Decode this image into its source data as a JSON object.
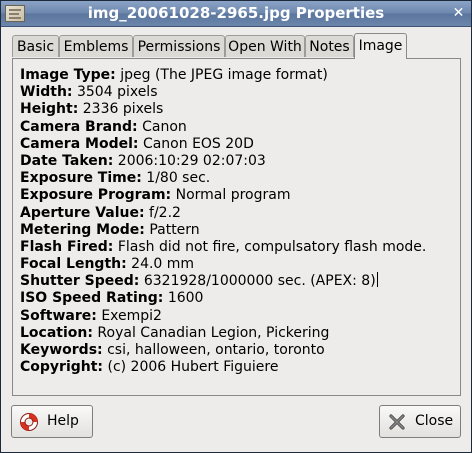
{
  "window": {
    "title": "img_20061028-2965.jpg Properties"
  },
  "icons": {
    "title": "image-file-icon",
    "close": "close-x-icon",
    "help": "lifebuoy-icon",
    "close_button": "close-x-icon"
  },
  "tabs": [
    {
      "label": "Basic",
      "active": false
    },
    {
      "label": "Emblems",
      "active": false
    },
    {
      "label": "Permissions",
      "active": false
    },
    {
      "label": "Open With",
      "active": false
    },
    {
      "label": "Notes",
      "active": false
    },
    {
      "label": "Image",
      "active": true
    }
  ],
  "fields": [
    {
      "label": "Image Type:",
      "value": "jpeg (The JPEG image format)"
    },
    {
      "label": "Width:",
      "value": "3504 pixels"
    },
    {
      "label": "Height:",
      "value": "2336 pixels"
    },
    {
      "label": "Camera Brand:",
      "value": "Canon"
    },
    {
      "label": "Camera Model:",
      "value": "Canon EOS 20D"
    },
    {
      "label": "Date Taken:",
      "value": "2006:10:29 02:07:03"
    },
    {
      "label": "Exposure Time:",
      "value": "1/80 sec."
    },
    {
      "label": "Exposure Program:",
      "value": "Normal program"
    },
    {
      "label": "Aperture Value:",
      "value": "f/2.2"
    },
    {
      "label": "Metering Mode:",
      "value": "Pattern"
    },
    {
      "label": "Flash Fired:",
      "value": "Flash did not fire, compulsatory flash mode."
    },
    {
      "label": "Focal Length:",
      "value": "24.0 mm"
    },
    {
      "label": "Shutter Speed:",
      "value": "6321928/1000000 sec. (APEX: 8)"
    },
    {
      "label": "ISO Speed Rating:",
      "value": "1600"
    },
    {
      "label": "Software:",
      "value": "Exempi2"
    },
    {
      "label": "Location:",
      "value": "Royal Canadian Legion, Pickering"
    },
    {
      "label": "Keywords:",
      "value": "csi, halloween, ontario, toronto"
    },
    {
      "label": "Copyright:",
      "value": "(c) 2006 Hubert Figuiere"
    }
  ],
  "buttons": {
    "help": "Help",
    "close": "Close"
  }
}
